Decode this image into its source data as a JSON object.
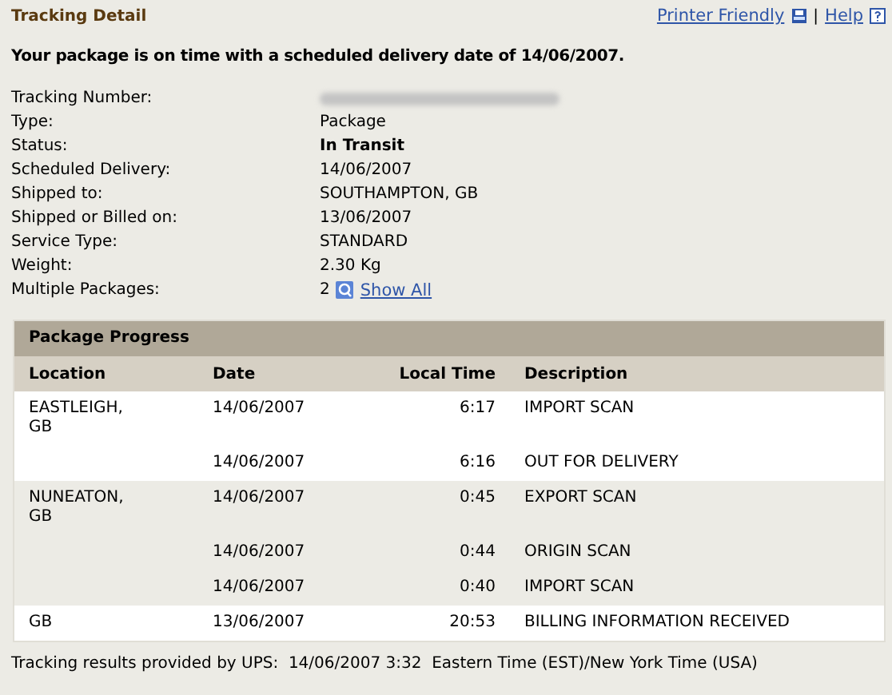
{
  "title": "Tracking Detail",
  "links": [
    {
      "label": "Printer Friendly",
      "kind": "printer"
    },
    {
      "label": "Help",
      "kind": "help"
    }
  ],
  "link_separator": "|",
  "summary": "Your package is on time with a scheduled delivery date of 14/06/2007.",
  "details": [
    {
      "label": "Tracking Number:",
      "kind": "redacted"
    },
    {
      "label": "Type:",
      "value": "Package",
      "kind": "text"
    },
    {
      "label": "Status:",
      "value": "In Transit",
      "kind": "strong"
    },
    {
      "label": "Scheduled Delivery:",
      "value": "14/06/2007",
      "kind": "text"
    },
    {
      "label": "Shipped to:",
      "value": "SOUTHAMPTON, GB",
      "kind": "text"
    },
    {
      "label": "Shipped or Billed on:",
      "value": "13/06/2007",
      "kind": "text"
    },
    {
      "label": "Service Type:",
      "value": "STANDARD",
      "kind": "text"
    },
    {
      "label": "Weight:",
      "value": "2.30 Kg",
      "kind": "text"
    },
    {
      "label": "Multiple Packages:",
      "value": "2",
      "link": "Show All",
      "kind": "link"
    }
  ],
  "progress": {
    "title": "Package Progress",
    "columns": [
      "Location",
      "Date",
      "Local Time",
      "Description"
    ],
    "groups": [
      {
        "location": "EASTLEIGH, GB",
        "rows": [
          {
            "date": "14/06/2007",
            "time": "6:17",
            "description": "IMPORT SCAN"
          },
          {
            "date": "14/06/2007",
            "time": "6:16",
            "description": "OUT FOR DELIVERY"
          }
        ]
      },
      {
        "location": "NUNEATON, GB",
        "rows": [
          {
            "date": "14/06/2007",
            "time": "0:45",
            "description": "EXPORT SCAN"
          },
          {
            "date": "14/06/2007",
            "time": "0:44",
            "description": "ORIGIN SCAN"
          },
          {
            "date": "14/06/2007",
            "time": "0:40",
            "description": "IMPORT SCAN"
          }
        ]
      },
      {
        "location": "GB",
        "rows": [
          {
            "date": "13/06/2007",
            "time": "20:53",
            "description": "BILLING INFORMATION RECEIVED"
          }
        ]
      }
    ]
  },
  "footer": "Tracking results provided by UPS:  14/06/2007 3:32  Eastern Time (EST)/New York Time (USA)"
}
